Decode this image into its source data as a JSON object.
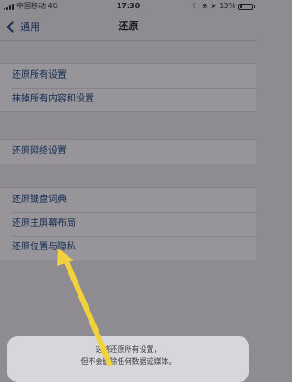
{
  "status_bar": {
    "carrier": "中国移动  4G",
    "time": "17:30",
    "battery": "13%",
    "battery_level": 0.13
  },
  "nav": {
    "back_label": "通用",
    "title": "还原"
  },
  "groups": [
    {
      "items": [
        "还原所有设置",
        "抹掉所有内容和设置"
      ]
    },
    {
      "items": [
        "还原网络设置"
      ]
    },
    {
      "items": [
        "还原键盘词典",
        "还原主屏幕布局",
        "还原位置与隐私"
      ]
    }
  ],
  "sheet": {
    "line1": "这将还原所有设置，",
    "line2": "但不会删除任何数据或媒体。"
  },
  "colors": {
    "accent": "#1b2f52",
    "arrow": "#f2d23c"
  }
}
